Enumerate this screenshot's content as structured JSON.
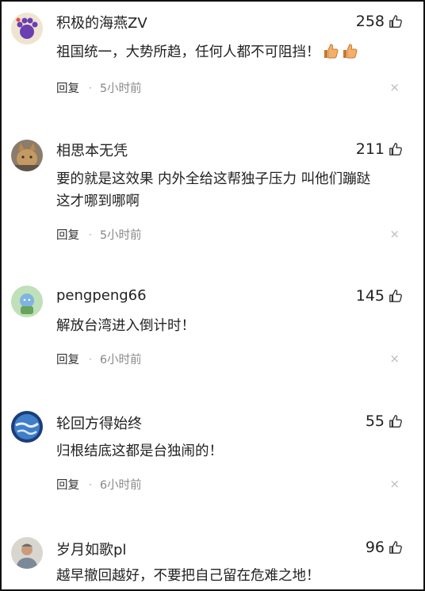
{
  "comments": [
    {
      "username": "积极的海燕ZV",
      "likes": "258",
      "content": "祖国统一，大势所趋，任何人都不可阻挡！",
      "emojis": [
        "thumbs-up",
        "thumbs-up"
      ],
      "reply_label": "回复",
      "separator": "·",
      "time": "5小时前",
      "close": "×",
      "avatar": "cat-paw-avatar"
    },
    {
      "username": "相思本无凭",
      "likes": "211",
      "content_lines": [
        "要的就是这效果 内外全给这帮独子压力 叫他们蹦跶",
        "这才哪到哪啊"
      ],
      "reply_label": "回复",
      "separator": "·",
      "time": "5小时前",
      "close": "×",
      "avatar": "cat-photo-avatar"
    },
    {
      "username": "pengpeng66",
      "likes": "145",
      "content": "解放台湾进入倒计时！",
      "reply_label": "回复",
      "separator": "·",
      "time": "6小时前",
      "close": "×",
      "avatar": "cartoon-avatar"
    },
    {
      "username": "轮回方得始终",
      "likes": "55",
      "content": "归根结底这都是台独闹的！",
      "reply_label": "回复",
      "separator": "·",
      "time": "6小时前",
      "close": "×",
      "avatar": "earth-avatar"
    },
    {
      "username": "岁月如歌pl",
      "likes": "96",
      "content": "越早撤回越好，不要把自己留在危难之地！",
      "avatar": "person-photo-avatar"
    }
  ],
  "colors": {
    "text": "#222222",
    "meta": "#888888",
    "close": "#bbbbbb"
  }
}
